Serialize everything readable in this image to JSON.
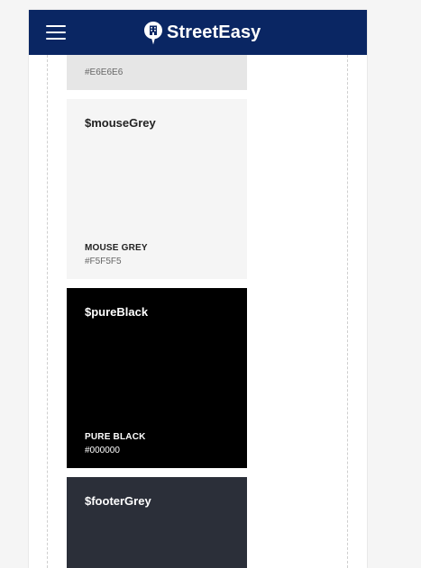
{
  "header": {
    "brand": "StreetEasy",
    "menu_icon": "hamburger-menu-icon",
    "logo_icon": "streeteasy-pin-logo-icon",
    "background": "#0a2663"
  },
  "swatches": [
    {
      "hex": "#E6E6E6",
      "color": "#e6e6e6"
    },
    {
      "variable": "$mouseGrey",
      "name": "MOUSE GREY",
      "hex": "#F5F5F5",
      "color": "#f5f5f5"
    },
    {
      "variable": "$pureBlack",
      "name": "PURE BLACK",
      "hex": "#000000",
      "color": "#000000"
    },
    {
      "variable": "$footerGrey",
      "color": "#2b2f39"
    }
  ]
}
